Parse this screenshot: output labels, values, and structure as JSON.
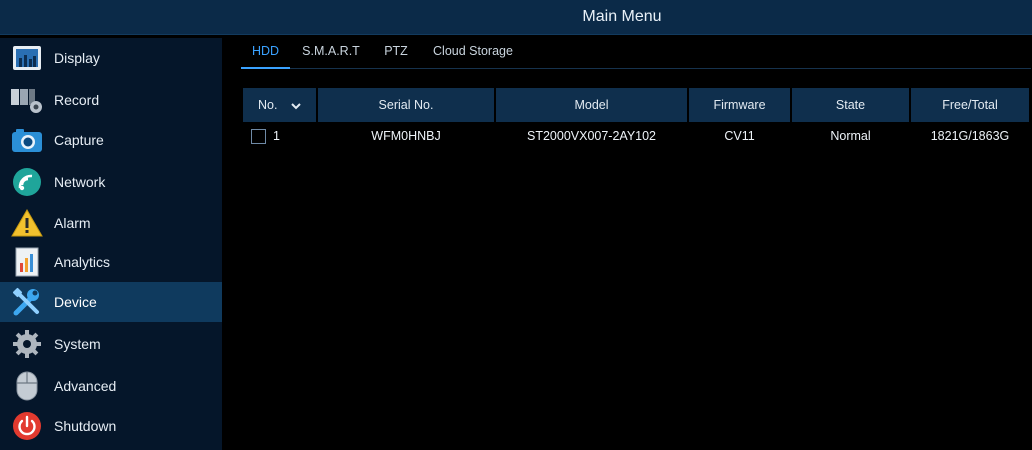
{
  "header": {
    "title": "Main Menu"
  },
  "sidebar": {
    "items": [
      {
        "label": "Display",
        "icon": "display-icon"
      },
      {
        "label": "Record",
        "icon": "record-icon"
      },
      {
        "label": "Capture",
        "icon": "camera-icon"
      },
      {
        "label": "Network",
        "icon": "network-icon"
      },
      {
        "label": "Alarm",
        "icon": "alarm-warning-icon"
      },
      {
        "label": "Analytics",
        "icon": "analytics-icon"
      },
      {
        "label": "Device",
        "icon": "tools-icon",
        "active": true
      },
      {
        "label": "System",
        "icon": "gear-icon"
      },
      {
        "label": "Advanced",
        "icon": "mouse-icon"
      },
      {
        "label": "Shutdown",
        "icon": "power-icon"
      }
    ]
  },
  "tabs": [
    {
      "label": "HDD",
      "active": true
    },
    {
      "label": "S.M.A.R.T"
    },
    {
      "label": "PTZ"
    },
    {
      "label": "Cloud Storage"
    }
  ],
  "table": {
    "headers": {
      "no": "No.",
      "serial": "Serial No.",
      "model": "Model",
      "firmware": "Firmware",
      "state": "State",
      "free_total": "Free/Total"
    },
    "rows": [
      {
        "no": "1",
        "serial": "WFM0HNBJ",
        "model": "ST2000VX007-2AY102",
        "firmware": "CV11",
        "state": "Normal",
        "free_total": "1821G/1863G"
      }
    ]
  },
  "colors": {
    "title_bar": "#0b2a48",
    "sidebar_bg": "#05162a",
    "active_item": "#0f3a5e",
    "accent": "#3aa2ff",
    "header_cell": "#0f2f4d"
  }
}
